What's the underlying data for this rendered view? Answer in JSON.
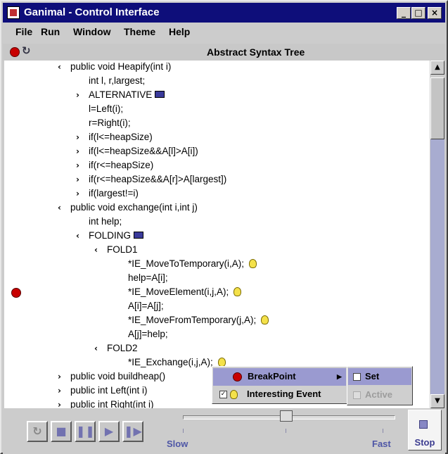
{
  "window": {
    "title": "Ganimal - Control Interface"
  },
  "menubar": {
    "items": [
      "File",
      "Run",
      "Window",
      "Theme",
      "Help"
    ]
  },
  "panel": {
    "title": "Abstract Syntax Tree"
  },
  "tree": {
    "rows": [
      {
        "text": "public void Heapify(int i)",
        "arrow": "<",
        "indent": 1
      },
      {
        "text": "int l, r,largest;",
        "arrow": "",
        "indent": 2
      },
      {
        "text": "ALTERNATIVE",
        "arrow": ">",
        "indent": 2,
        "icon": "note"
      },
      {
        "text": "l=Left(i);",
        "arrow": "",
        "indent": 2
      },
      {
        "text": "r=Right(i);",
        "arrow": "",
        "indent": 2
      },
      {
        "text": "if(l<=heapSize)",
        "arrow": ">",
        "indent": 2
      },
      {
        "text": "if(l<=heapSize&&A[l]>A[i])",
        "arrow": ">",
        "indent": 2
      },
      {
        "text": "if(r<=heapSize)",
        "arrow": ">",
        "indent": 2
      },
      {
        "text": "if(r<=heapSize&&A[r]>A[largest])",
        "arrow": ">",
        "indent": 2
      },
      {
        "text": "if(largest!=i)",
        "arrow": ">",
        "indent": 2
      },
      {
        "text": "public void exchange(int i,int j)",
        "arrow": "<",
        "indent": 1
      },
      {
        "text": "int help;",
        "arrow": "",
        "indent": 2
      },
      {
        "text": "FOLDING",
        "arrow": "<",
        "indent": 2,
        "icon": "note"
      },
      {
        "text": "FOLD1",
        "arrow": "<",
        "indent": 3
      },
      {
        "text": "*IE_MoveToTemporary(i,A);",
        "arrow": "",
        "indent": 4,
        "icon": "bulb"
      },
      {
        "text": "help=A[i];",
        "arrow": "",
        "indent": 4
      },
      {
        "text": "*IE_MoveElement(i,j,A);",
        "arrow": "",
        "indent": 4,
        "icon": "bulb",
        "breakpoint": true
      },
      {
        "text": "A[i]=A[j];",
        "arrow": "",
        "indent": 4
      },
      {
        "text": "*IE_MoveFromTemporary(j,A);",
        "arrow": "",
        "indent": 4,
        "icon": "bulb"
      },
      {
        "text": "A[j]=help;",
        "arrow": "",
        "indent": 4
      },
      {
        "text": "FOLD2",
        "arrow": "<",
        "indent": 3
      },
      {
        "text": "*IE_Exchange(i,j,A);",
        "arrow": "",
        "indent": 4,
        "icon": "bulb"
      },
      {
        "text": "public void buildheap()",
        "arrow": ">",
        "indent": 1
      },
      {
        "text": "public int Left(int i)",
        "arrow": ">",
        "indent": 1
      },
      {
        "text": "public int Right(int i)",
        "arrow": ">",
        "indent": 1
      }
    ]
  },
  "context_menu": {
    "breakpoint_label": "BreakPoint",
    "interesting_label": "Interesting Event",
    "submenu": {
      "set_label": "Set",
      "active_label": "Active"
    }
  },
  "controls": {
    "slow_label": "Slow",
    "fast_label": "Fast",
    "stop_label": "Stop",
    "speed_fraction": 0.5
  },
  "colors": {
    "titlebar": "#0e0e7a",
    "selection": "#9a9ad0",
    "accent": "#4e56a6"
  }
}
